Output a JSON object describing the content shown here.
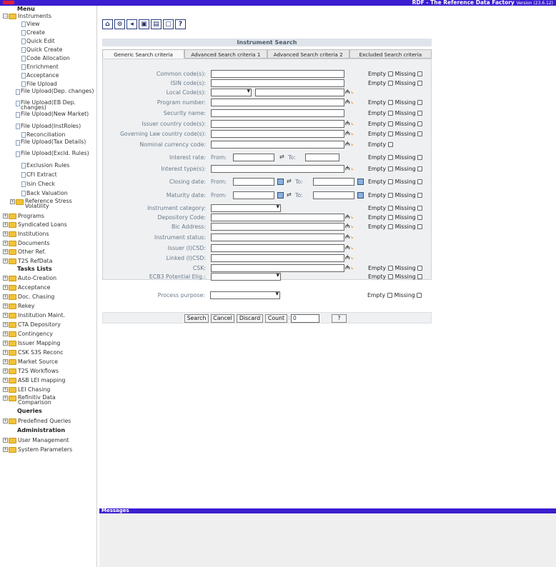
{
  "app": {
    "title": "RDF - The Reference Data Factory",
    "version": "Version (23.6.12)",
    "logo_color": "#e0203a",
    "header_color": "#3a1ed0"
  },
  "toolbar": {
    "icons": [
      "home-icon",
      "search-doc-icon",
      "back-icon",
      "image-icon",
      "print-icon",
      "save-icon",
      "help-icon"
    ],
    "help_label": "?"
  },
  "sidebar": {
    "menu_heading": "Menu",
    "instruments_label": "Instruments",
    "instrument_items": [
      "View",
      "Create",
      "Quick Edit",
      "Quick Create",
      "Code Allocation",
      "Enrichment",
      "Acceptance",
      "File Upload",
      "File Upload(Dep. changes)",
      "File Upload(EB Dep. changes)",
      "File Upload(New Market)",
      "File Upload(InstRoles)",
      "Reconciliation",
      "File Upload(Tax Details)",
      "File Upload(Excld. Rules)",
      "Exclusion Rules",
      "CFI Extract",
      "Isin Check",
      "Back Valuation"
    ],
    "ref_stress_label": "Reference Stress Volatility",
    "menu_groups": [
      "Programs",
      "Syndicated Loans",
      "Institutions",
      "Documents",
      "Other Ref.",
      "T2S RefData"
    ],
    "tasks_heading": "Tasks Lists",
    "task_items": [
      "Auto-Creation",
      "Acceptance",
      "Doc. Chasing",
      "Rekey",
      "Institution Maint.",
      "CTA Depository",
      "Contingency",
      "Issuer Mapping",
      "CSK S3S Reconc",
      "Market Source",
      "T2S Workflows",
      "ASB LEI mapping",
      "LEI Chasing",
      "Refinitiv Data Comparison"
    ],
    "queries_heading": "Queries",
    "query_items": [
      "Predefined Queries"
    ],
    "admin_heading": "Administration",
    "admin_items": [
      "User Management",
      "System Parameters"
    ]
  },
  "search": {
    "title": "Instrument Search",
    "tabs": [
      "Generic Search criteria",
      "Advanced Search criteria 1",
      "Advanced Search criteria 2",
      "Excluded Search criteria"
    ],
    "active_tab": 0,
    "empty_label": "Empty",
    "missing_label": "Missing",
    "from_label": "From:",
    "to_label": "To:",
    "fields": [
      "Common code(s):",
      "ISIN code(s):",
      "Local Code(s):",
      "Program number:",
      "Security name:",
      "Issuer country code(s):",
      "Governing Law country code(s):",
      "Nominal currency code:",
      "Interest rate:",
      "Interest type(s):",
      "Closing date:",
      "Maturity date:",
      "Instrument category:",
      "Depository Code:",
      "Bic Address:",
      "Instrument status:",
      "Issuer (I)CSD:",
      "Linked (I)CSD:",
      "CSK:",
      "ECB3 Potential Elig.:",
      "Process purpose:"
    ]
  },
  "actions": {
    "search": "Search",
    "cancel": "Cancel",
    "discard": "Discard",
    "count": "Count",
    "count_sep": ":",
    "count_value": "0",
    "help": "?"
  },
  "messages": {
    "heading": "Messages"
  }
}
